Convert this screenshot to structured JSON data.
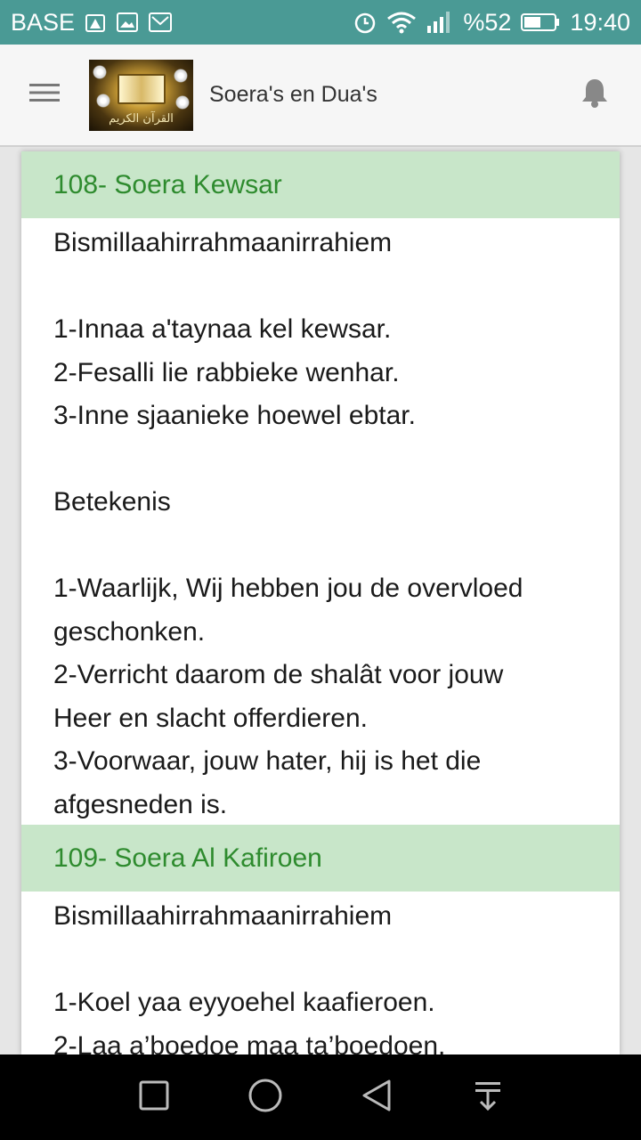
{
  "status_bar": {
    "carrier": "BASE",
    "battery_percent": "%52",
    "time": "19:40",
    "icons": [
      "warning-icon",
      "image-icon",
      "mail-icon",
      "alarm-icon",
      "wifi-icon",
      "signal-icon",
      "battery-icon"
    ]
  },
  "app_bar": {
    "title": "Soera's en Dua's",
    "logo_text": "القرآن الكريم",
    "icons": [
      "menu-icon",
      "bell-icon"
    ]
  },
  "sections": [
    {
      "title": "108- Soera Kewsar",
      "lines": [
        "Bismillaahirrahmaanirrahiem",
        "",
        "1-Innaa a'taynaa kel kewsar.",
        "2-Fesalli lie rabbieke wenhar.",
        "3-Inne sjaanieke hoewel ebtar.",
        "",
        "Betekenis",
        "",
        "1-Waarlijk, Wij hebben jou de overvloed",
        "geschonken.",
        "2-Verricht daarom de shalât voor jouw",
        "Heer en slacht offerdieren.",
        "3-Voorwaar, jouw hater, hij is het die",
        "afgesneden is."
      ]
    },
    {
      "title": "109- Soera Al Kafiroen",
      "lines": [
        "Bismillaahirrahmaanirrahiem",
        "",
        "1-Koel yaa eyyoehel kaafieroen.",
        "2-Laa a’boedoe maa ta’boedoen."
      ]
    }
  ],
  "nav_bar": {
    "icons": [
      "recent-apps-icon",
      "home-icon",
      "back-icon",
      "notification-drawer-icon"
    ]
  },
  "colors": {
    "status_bar": "#4a9a95",
    "section_header_bg": "#c8e6c9",
    "section_header_text": "#2e8b2e"
  }
}
